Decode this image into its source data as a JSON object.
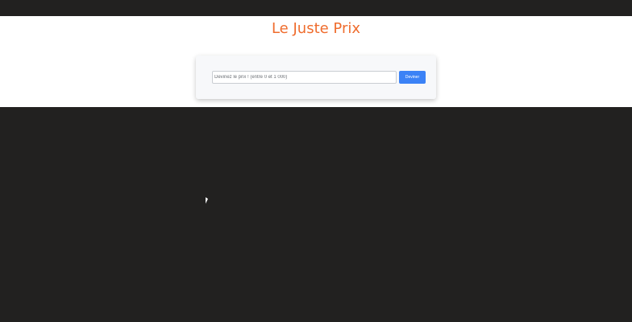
{
  "page": {
    "title": "Le Juste Prix"
  },
  "game": {
    "input_placeholder": "Devinez le prix ! (entre 0 et 1 000)",
    "input_value": "",
    "button_label": "Deviner"
  },
  "colors": {
    "title": "#ef6c2d",
    "button": "#3b82f6",
    "background": "#222120",
    "card": "#f7f8fa"
  }
}
